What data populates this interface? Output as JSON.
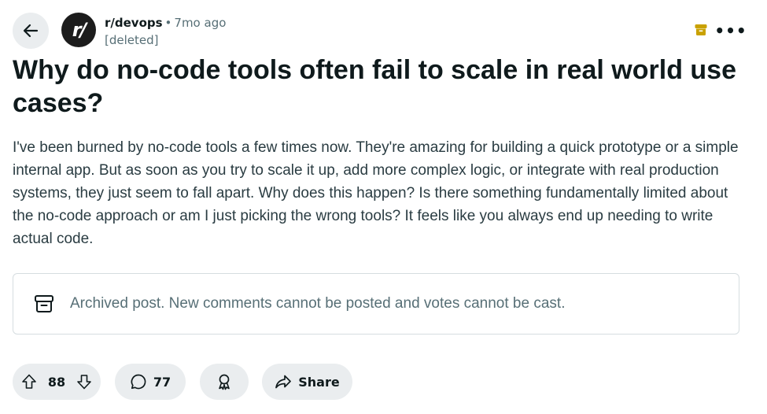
{
  "post": {
    "subreddit": "r/devops",
    "separator": "•",
    "time_ago": "7mo ago",
    "author": "[deleted]",
    "avatar_text": "r/",
    "title": "Why do no-code tools often fail to scale in real world use cases?",
    "body": "I've been burned by no-code tools a few times now. They're amazing for building a quick prototype or a simple internal app. But as soon as you try to scale it up, add more complex logic, or integrate with real production systems, they just seem to fall apart. Why does this happen? Is there something fundamentally limited about the no-code approach or am I just picking the wrong tools? It feels like you always end up needing to write actual code."
  },
  "notice": {
    "text": "Archived post. New comments cannot be posted and votes cannot be cast.",
    "icon": "archive-icon"
  },
  "actions": {
    "vote_count": "88",
    "comment_count": "77",
    "share_label": "Share"
  },
  "header": {
    "overflow_label": "•••"
  },
  "colors": {
    "pill_bg": "#eaedef",
    "archive_badge": "#c9a100",
    "text_secondary": "#576f76"
  }
}
